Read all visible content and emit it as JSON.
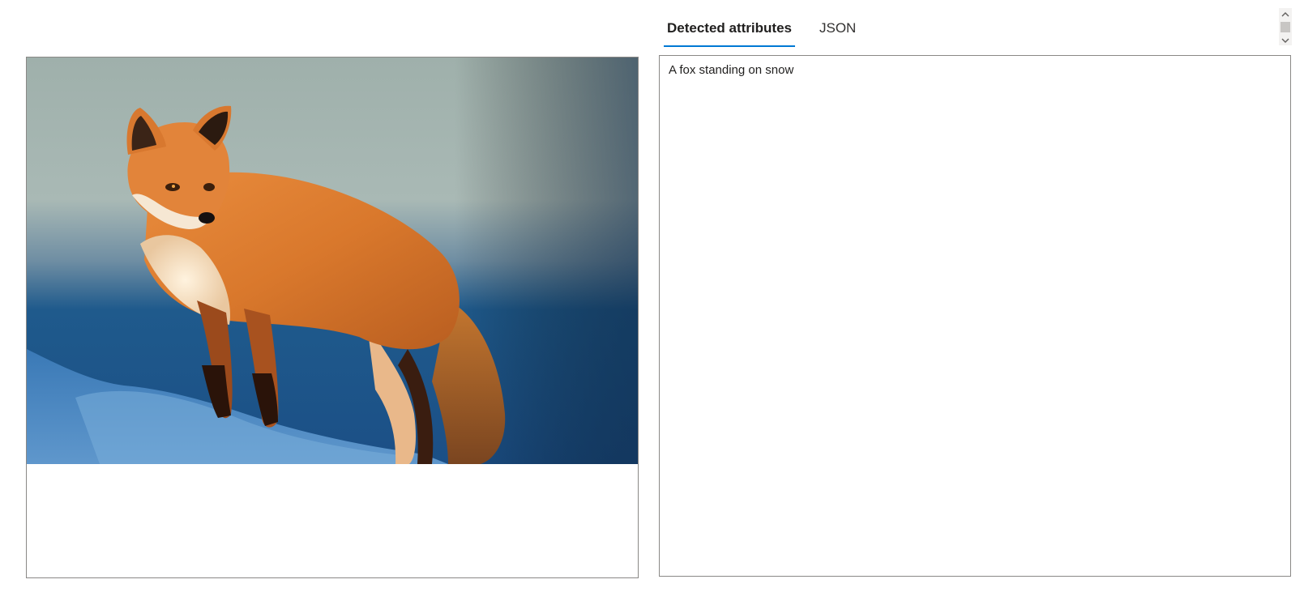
{
  "tabs": [
    {
      "label": "Detected attributes",
      "active": true
    },
    {
      "label": "JSON",
      "active": false
    }
  ],
  "result": {
    "caption": "A fox standing on snow"
  },
  "preview": {
    "image_subject": "fox-on-snow-photo"
  },
  "icons": {
    "scroll_up": "chevron-up-icon",
    "scroll_down": "chevron-down-icon"
  },
  "colors": {
    "tab_underline": "#0078d4",
    "border": "#8a8886",
    "text": "#201f1e"
  }
}
